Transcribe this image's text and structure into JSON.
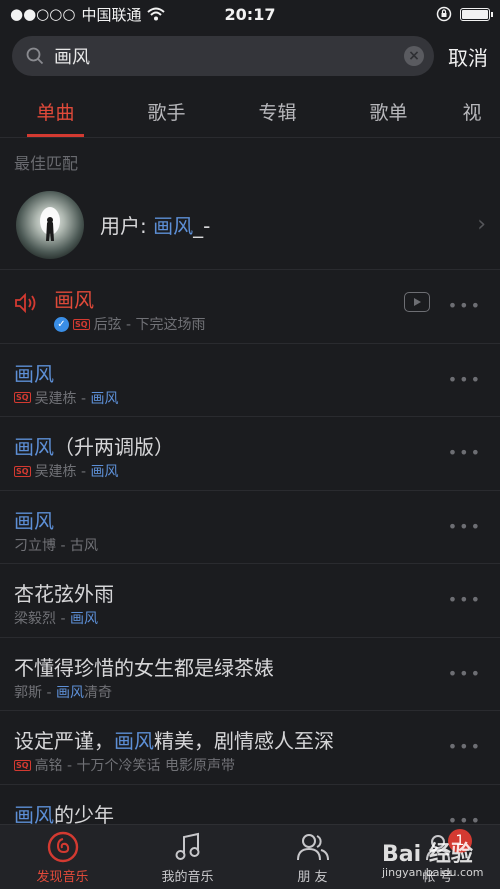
{
  "status_bar": {
    "signal": "●●○○○",
    "carrier": "中国联通",
    "time": "20:17",
    "battery_level": 1.0
  },
  "search": {
    "query": "画风",
    "cancel_label": "取消",
    "clear_icon": "close-circle-icon"
  },
  "tabs": [
    {
      "label": "单曲",
      "active": true
    },
    {
      "label": "歌手",
      "active": false
    },
    {
      "label": "专辑",
      "active": false
    },
    {
      "label": "歌单",
      "active": false
    },
    {
      "label": "视",
      "active": false
    }
  ],
  "best_match": {
    "section_title": "最佳匹配",
    "user_prefix": "用户: ",
    "user_highlight": "画风",
    "user_suffix": "_-"
  },
  "songs": [
    {
      "title_parts": [
        {
          "text": "画风",
          "hl": false
        }
      ],
      "sub_parts": [
        {
          "text": "后弦 - 下完这场雨",
          "hl": false
        }
      ],
      "sq": true,
      "verified": true,
      "playing": true,
      "mv": true
    },
    {
      "title_parts": [
        {
          "text": "画风",
          "hl": true
        }
      ],
      "sub_parts": [
        {
          "text": "吴建栋 - ",
          "hl": false
        },
        {
          "text": "画风",
          "hl": true
        }
      ],
      "sq": true,
      "verified": false,
      "playing": false,
      "mv": false
    },
    {
      "title_parts": [
        {
          "text": "画风",
          "hl": true
        },
        {
          "text": "（升两调版）",
          "hl": false
        }
      ],
      "sub_parts": [
        {
          "text": "吴建栋 - ",
          "hl": false
        },
        {
          "text": "画风",
          "hl": true
        }
      ],
      "sq": true,
      "verified": false,
      "playing": false,
      "mv": false
    },
    {
      "title_parts": [
        {
          "text": "画风",
          "hl": true
        }
      ],
      "sub_parts": [
        {
          "text": "刁立博 - 古风",
          "hl": false
        }
      ],
      "sq": false,
      "verified": false,
      "playing": false,
      "mv": false
    },
    {
      "title_parts": [
        {
          "text": "杏花弦外雨",
          "hl": false
        }
      ],
      "sub_parts": [
        {
          "text": "梁毅烈 - ",
          "hl": false
        },
        {
          "text": "画风",
          "hl": true
        }
      ],
      "sq": false,
      "verified": false,
      "playing": false,
      "mv": false
    },
    {
      "title_parts": [
        {
          "text": "不懂得珍惜的女生都是绿茶婊",
          "hl": false
        }
      ],
      "sub_parts": [
        {
          "text": "郭斯 - ",
          "hl": false
        },
        {
          "text": "画风",
          "hl": true
        },
        {
          "text": "清奇",
          "hl": false
        }
      ],
      "sq": false,
      "verified": false,
      "playing": false,
      "mv": false
    },
    {
      "title_parts": [
        {
          "text": "设定严谨，",
          "hl": false
        },
        {
          "text": "画风",
          "hl": true
        },
        {
          "text": "精美，剧情感人至深",
          "hl": false
        }
      ],
      "sub_parts": [
        {
          "text": "高铭 - 十万个冷笑话 电影原声带",
          "hl": false
        }
      ],
      "sq": true,
      "verified": false,
      "playing": false,
      "mv": false
    },
    {
      "title_parts": [
        {
          "text": "画风",
          "hl": true
        },
        {
          "text": "的少年",
          "hl": false
        }
      ],
      "sub_parts": [],
      "sq": false,
      "verified": false,
      "playing": false,
      "mv": false
    }
  ],
  "bottom_nav": [
    {
      "label": "发现音乐",
      "icon": "netease-music-icon",
      "active": true
    },
    {
      "label": "我的音乐",
      "icon": "music-note-icon",
      "active": false
    },
    {
      "label": "朋 友",
      "icon": "friends-icon",
      "active": false
    },
    {
      "label": "帐 号",
      "icon": "account-icon",
      "active": false,
      "badge": "1"
    }
  ],
  "watermark": {
    "main": "Bai 经验",
    "sub": "jingyan.baidu.com"
  },
  "colors": {
    "accent": "#d33a31",
    "highlight": "#5d8fd6",
    "background": "#1b1c1f"
  }
}
